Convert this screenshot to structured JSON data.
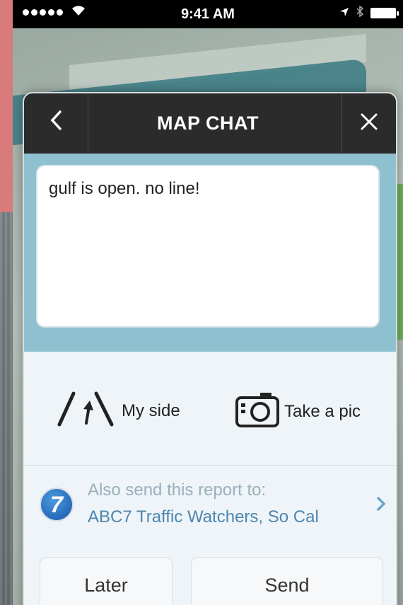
{
  "status_bar": {
    "time": "9:41 AM"
  },
  "dialog": {
    "title": "MAP CHAT",
    "message_text": "gulf is open. no line!",
    "actions": {
      "my_side_label": "My side",
      "take_pic_label": "Take a pic"
    },
    "report": {
      "line1": "Also send this report to:",
      "line2": "ABC7 Traffic Watchers, So Cal",
      "logo_text": "7"
    },
    "buttons": {
      "later": "Later",
      "send": "Send"
    }
  },
  "colors": {
    "header_bg": "#2b2b2b",
    "accent_blue": "#4d86b0",
    "text_area_frame": "#8fc0d0"
  }
}
